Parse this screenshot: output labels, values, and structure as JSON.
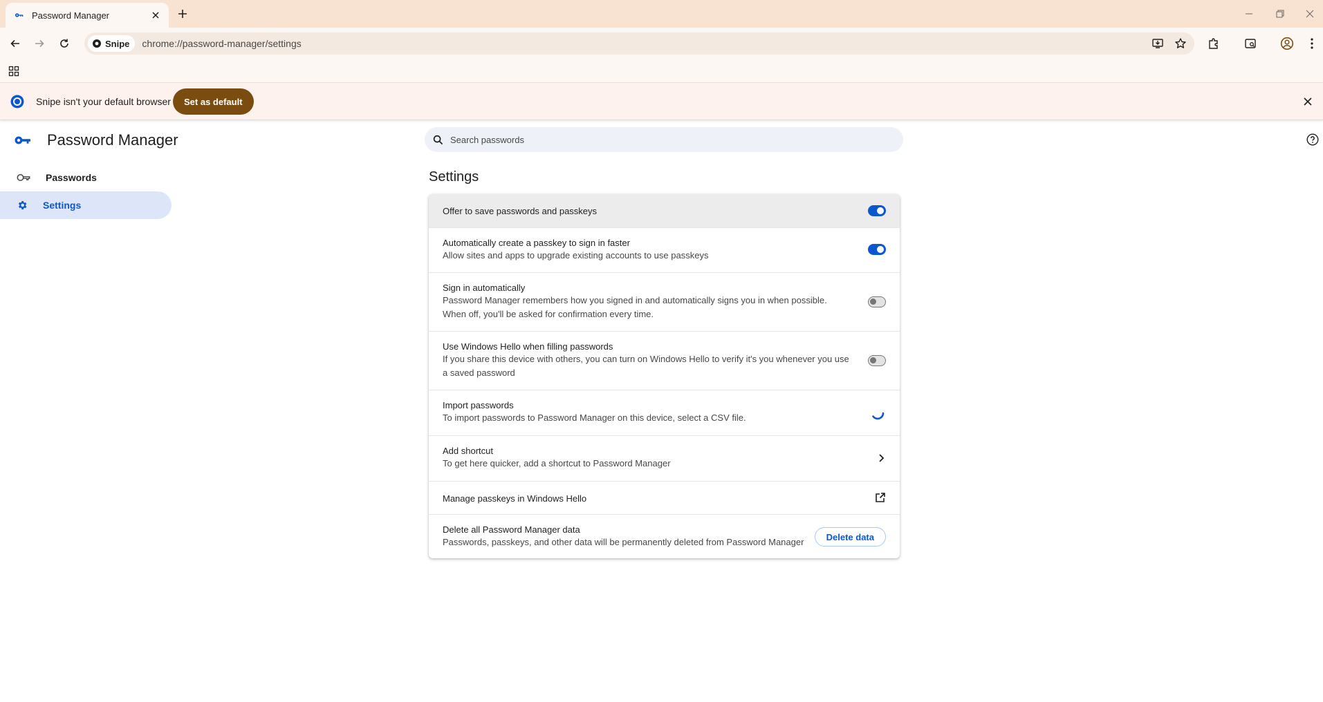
{
  "browser": {
    "tab_title": "Password Manager",
    "site_chip": "Snipe",
    "url": "chrome://password-manager/settings"
  },
  "infobar": {
    "message": "Snipe isn't your default browser",
    "button": "Set as default"
  },
  "sidebar": {
    "app_title": "Password Manager",
    "items": [
      {
        "label": "Passwords",
        "icon": "key-outline-icon",
        "active": false
      },
      {
        "label": "Settings",
        "icon": "gear-icon",
        "active": true
      }
    ]
  },
  "search": {
    "placeholder": "Search passwords"
  },
  "settings": {
    "title": "Settings",
    "rows": [
      {
        "label": "Offer to save passwords and passkeys",
        "control": "toggle",
        "state": "on"
      },
      {
        "label": "Automatically create a passkey to sign in faster",
        "sub": "Allow sites and apps to upgrade existing accounts to use passkeys",
        "control": "toggle",
        "state": "on"
      },
      {
        "label": "Sign in automatically",
        "sub": "Password Manager remembers how you signed in and automatically signs you in when possible. When off, you'll be asked for confirmation every time.",
        "control": "toggle",
        "state": "off"
      },
      {
        "label": "Use Windows Hello when filling passwords",
        "sub": "If you share this device with others, you can turn on Windows Hello to verify it's you whenever you use a saved password",
        "control": "toggle",
        "state": "off"
      },
      {
        "label": "Import passwords",
        "sub": "To import passwords to Password Manager on this device, select a CSV file.",
        "control": "spinner"
      },
      {
        "label": "Add shortcut",
        "sub": "To get here quicker, add a shortcut to Password Manager",
        "control": "chevron-right-icon"
      },
      {
        "label": "Manage passkeys in Windows Hello",
        "control": "open-in-new-icon"
      },
      {
        "label": "Delete all Password Manager data",
        "sub": "Passwords, passkeys, and other data will be permanently deleted from Password Manager",
        "control": "button",
        "button_label": "Delete data"
      }
    ]
  },
  "colors": {
    "titlebar": "#f8e2d2",
    "accent": "#0b57d0",
    "set_default_button": "#7b4c10",
    "active_nav_bg": "#dde6f8"
  }
}
